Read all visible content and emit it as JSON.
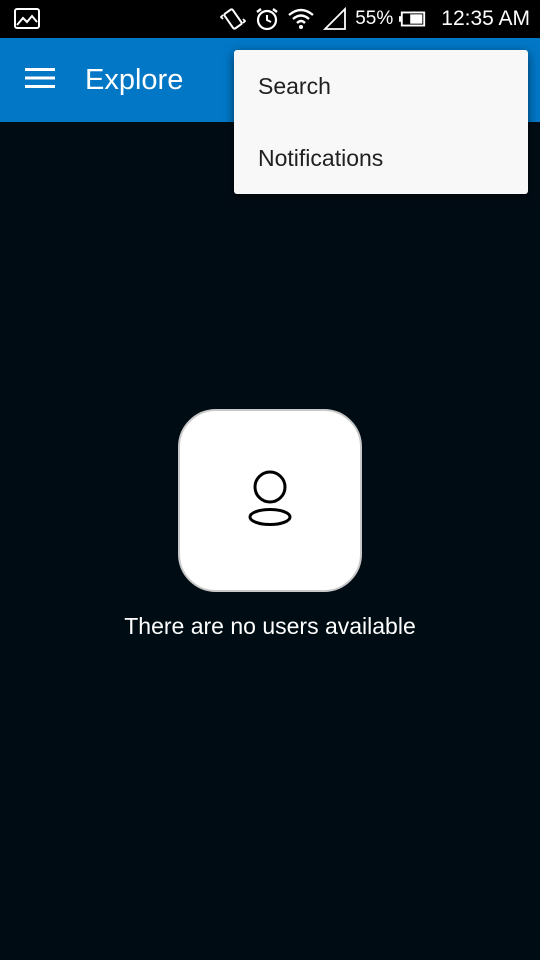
{
  "status_bar": {
    "battery_percent": "55%",
    "time": "12:35 AM",
    "icons": [
      "image-icon",
      "vibrate-icon",
      "alarm-icon",
      "wifi-icon",
      "signal-icon",
      "battery-icon"
    ]
  },
  "app_bar": {
    "title": "Explore",
    "menu_icon": "hamburger-menu-icon",
    "color": "#0277c6"
  },
  "overflow_menu": {
    "items": [
      {
        "label": "Search"
      },
      {
        "label": "Notifications"
      }
    ]
  },
  "empty_state": {
    "icon": "user-icon",
    "message": "There are no users available"
  },
  "colors": {
    "background": "#000c14",
    "status_bar": "#000000",
    "menu_background": "#f8f8f8"
  }
}
